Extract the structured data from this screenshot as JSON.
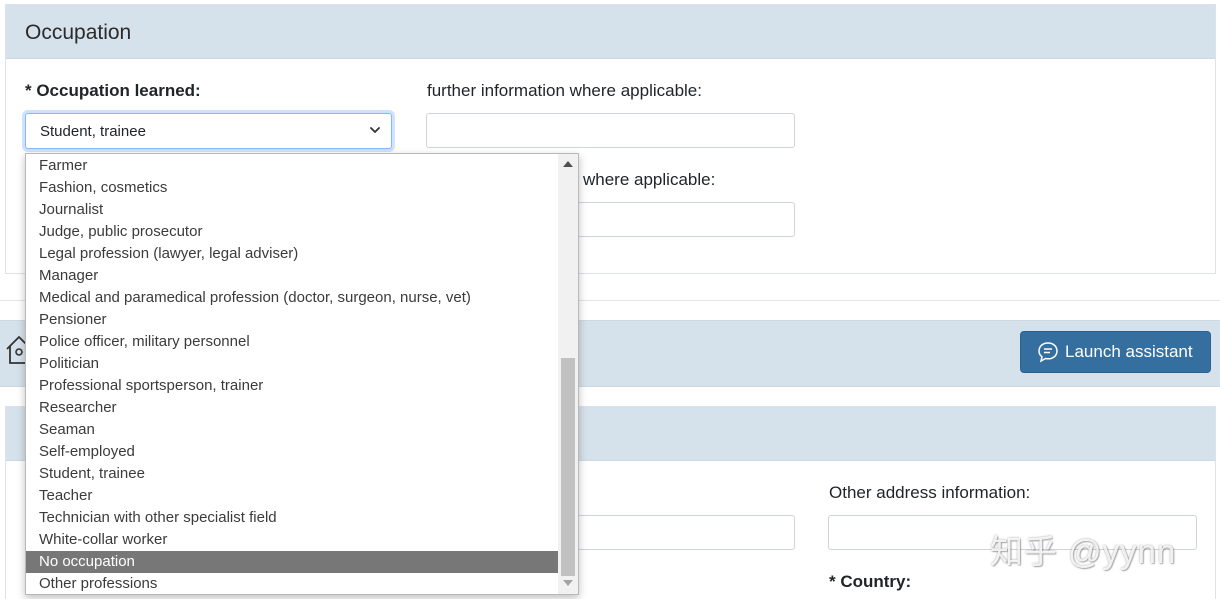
{
  "occupation_section": {
    "title": "Occupation",
    "occupation_learned_label": "* Occupation learned:",
    "occupation_learned_value": "Student, trainee",
    "further_info_label": "further information where applicable:",
    "further_info_value": "",
    "further_info_label_2_visible": "where applicable:",
    "further_info_value_2": ""
  },
  "address_section": {
    "launch_button_label": "Launch assistant",
    "other_address_label": "Other address information:",
    "other_address_value": "",
    "country_label": "* Country:"
  },
  "dropdown": {
    "options": [
      "Farmer",
      "Fashion, cosmetics",
      "Journalist",
      "Judge, public prosecutor",
      "Legal profession (lawyer, legal adviser)",
      "Manager",
      "Medical and paramedical profession (doctor, surgeon, nurse, vet)",
      "Pensioner",
      "Police officer, military personnel",
      "Politician",
      "Professional sportsperson, trainer",
      "Researcher",
      "Seaman",
      "Self-employed",
      "Student, trainee",
      "Teacher",
      "Technician with other specialist field",
      "White-collar worker",
      "No occupation",
      "Other professions"
    ],
    "highlighted_option": "No occupation"
  },
  "watermark": "知乎 @yynn",
  "colors": {
    "section_header_bg": "#d6e2eb",
    "primary_button": "#346f9f",
    "highlight": "#777777"
  },
  "icons": {
    "home": "home-icon",
    "chat": "chat-bubble-icon",
    "chevron": "chevron-down-icon"
  }
}
